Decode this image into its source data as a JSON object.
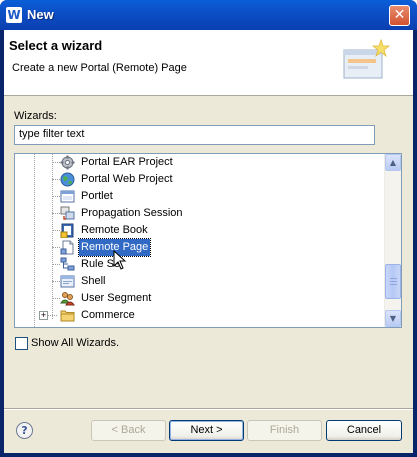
{
  "window": {
    "title": "New",
    "app_icon": "W"
  },
  "header": {
    "title": "Select a wizard",
    "description": "Create a new Portal (Remote) Page"
  },
  "wizards": {
    "label": "Wizards:",
    "filter_value": "type filter text",
    "items": [
      {
        "label": "Portal EAR Project",
        "icon": "gear-icon"
      },
      {
        "label": "Portal Web Project",
        "icon": "globe-icon"
      },
      {
        "label": "Portlet",
        "icon": "portlet-icon"
      },
      {
        "label": "Propagation Session",
        "icon": "propagation-icon"
      },
      {
        "label": "Remote Book",
        "icon": "book-icon"
      },
      {
        "label": "Remote Page",
        "icon": "page-icon",
        "selected": true
      },
      {
        "label": "Rule Se",
        "icon": "rule-icon"
      },
      {
        "label": "Shell",
        "icon": "shell-icon"
      },
      {
        "label": "User Segment",
        "icon": "users-icon"
      },
      {
        "label": "Commerce",
        "icon": "folder-icon",
        "collapsed": true
      }
    ]
  },
  "show_all": {
    "label": "Show All Wizards.",
    "checked": false
  },
  "buttons": {
    "help": "?",
    "back": "< Back",
    "next": "Next >",
    "finish": "Finish",
    "cancel": "Cancel"
  },
  "colors": {
    "titlebar": "#0a5fd8",
    "selection": "#316ac5",
    "dialog_bg": "#ece9d8"
  }
}
